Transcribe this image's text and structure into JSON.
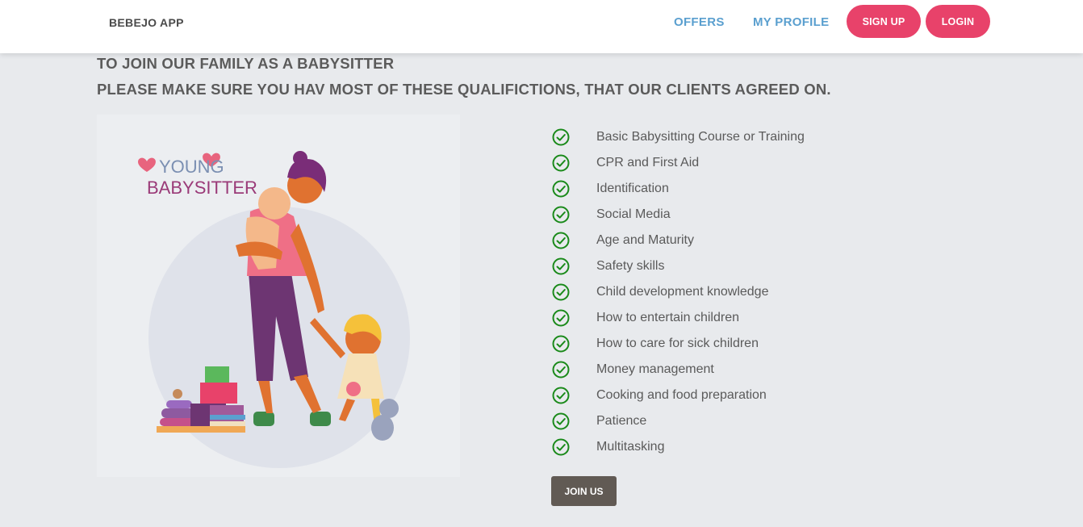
{
  "header": {
    "brand": "BEBEJO APP",
    "nav": {
      "offers": "OFFERS",
      "my_profile": "MY PROFILE"
    },
    "sign_up": "SIGN UP",
    "login": "LOGIN"
  },
  "main": {
    "heading_line1": "TO JOIN OUR FAMILY AS A BABYSITTER",
    "heading_line2": "PLEASE MAKE SURE YOU HAV MOST OF THESE QUALIFICTIONS, THAT OUR CLIENTS AGREED ON.",
    "illustration": {
      "title_line1": "YOUNG",
      "title_line2": "BABYSITTER"
    },
    "qualifications": [
      "Basic Babysitting Course or Training",
      "CPR and First Aid",
      "Identification",
      "Social Media",
      "Age and Maturity",
      "Safety skills",
      "Child development knowledge",
      "How to entertain children",
      "How to care for sick children",
      "Money management",
      "Cooking and food preparation",
      "Patience",
      "Multitasking"
    ],
    "join_button": "JOIN US"
  },
  "colors": {
    "accent": "#e8426a",
    "nav_link": "#5a9fcf",
    "check": "#1a8a1a",
    "join_button": "#615a54",
    "background": "#e8eaed"
  }
}
